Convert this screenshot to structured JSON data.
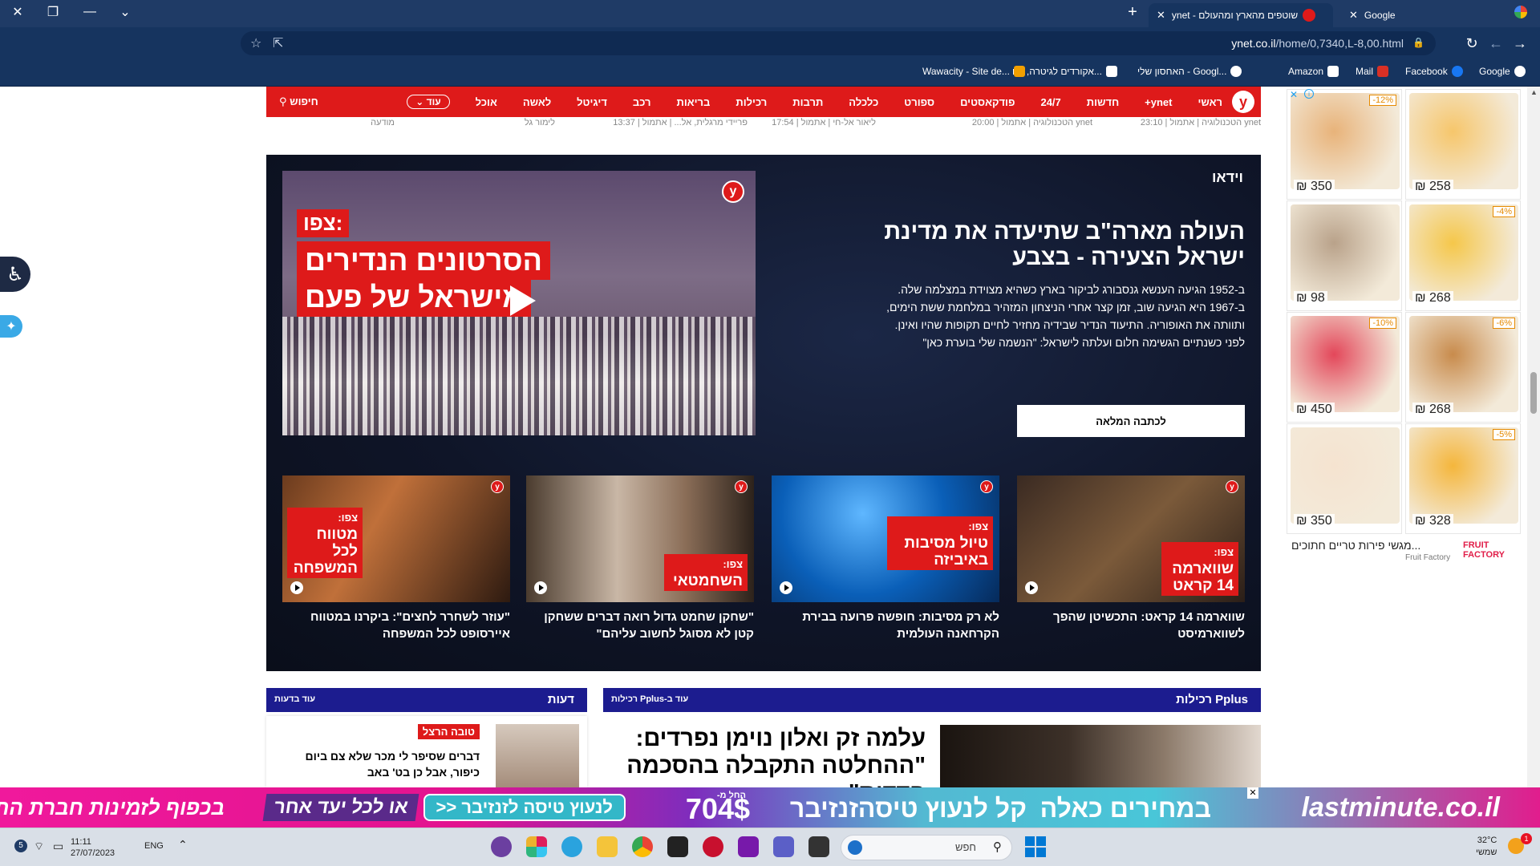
{
  "browser": {
    "tabs": [
      {
        "label": "ynet - שוטפים מהארץ ומהעולם",
        "active": true
      },
      {
        "label": "Google",
        "active": false
      }
    ],
    "url": {
      "host": "ynet.co.il",
      "path": "/home/0,7340,L-8,00.html"
    },
    "bookmarks": [
      "Google",
      "Facebook",
      "Mail",
      "Amazon",
      "האחסון שלי - Googl...",
      "אקורדים לגיטרה, תוו...",
      "Wawacity - Site de..."
    ]
  },
  "nav": {
    "logo": "y",
    "items": [
      "ראשי",
      "ynet+",
      "חדשות",
      "24/7",
      "פודקאסטים",
      "ספורט",
      "כלכלה",
      "תרבות",
      "רכילות",
      "בריאות",
      "רכב",
      "דיגיטל",
      "לאשה",
      "אוכל"
    ],
    "more": "עוד",
    "search": "חיפוש"
  },
  "meta_row": [
    "ynet הטכנולוגיה | אתמול | 23:10",
    "ynet הטכנולוגיה | אתמול | 20:00",
    "ליאור אל-חי | אתמול | 17:54",
    "פריידי מרגלית, אל... | אתמול | 13:37",
    "לימור גל",
    "מודעה"
  ],
  "video": {
    "section_label": "וידאו",
    "main_thumb": {
      "caption_label": "צפו:",
      "caption_line1": "הסרטונים הנדירים",
      "caption_line2": "מישראל של פעם",
      "badge": "y"
    },
    "title": "העולה מארה\"ב שתיעדה את מדינת ישראל הצעירה - בצבע",
    "description": [
      "ב-1952 הגיעה הענשא גנסבורג לביקור בארץ כשהיא מצוידת במצלמה שלה.",
      "ב-1967 היא הגיעה שוב, זמן קצר אחרי הניצחון המזהיר במלחמת ששת הימים,",
      "ותוותה את האופוריה. התיעוד הנדיר שבידיה מחזיר לחיים תקופות שהיו ואינן.",
      "לפני כשנתיים הגשימה חלום ועלתה לישראל: \"הנשמה שלי בוערת כאן\""
    ],
    "read_more": "לכתבה המלאה",
    "items": [
      {
        "caption_label": "צפו:",
        "caption": "שווארמה 14 קראט",
        "title": "שווארמה 14 קראט: התכשיטן שהפך לשווארמיסט"
      },
      {
        "caption_label": "צפו:",
        "caption": "טיול מסיבות באיביזה",
        "title": "לא רק מסיבות: חופשה פרועה בבירת הקרחאנה העולמית"
      },
      {
        "caption_label": "צפו:",
        "caption": "השחמטאי",
        "title": "\"שחקן שחמט גדול רואה דברים ששחקן קטן לא מסוגל לחשוב עליהם\""
      },
      {
        "caption_label": "צפו:",
        "caption": "מטווח לכל המשפחה",
        "title": "\"עוזר לשחרר לחצים\": ביקרנו במטווח איירסופט לכל המשפחה"
      }
    ]
  },
  "pplus": {
    "title": "Pplus רכילות",
    "more": "עוד ב-Pplus רכילות",
    "headline": "עלמה זק ואלון נוימן נפרדים: \"ההחלטה התקבלה בהסכמה הדדית\""
  },
  "opinions": {
    "title": "דעות",
    "more": "עוד בדעות",
    "author_tag": "טובה הרצל",
    "text": "דברים שסיפר לי מכר שלא צם ביום כיפור, אבל כן בט' באב"
  },
  "ad": {
    "items": [
      {
        "price": "₪ 258",
        "discount": "",
        "color": "#f6c66b"
      },
      {
        "price": "₪ 350",
        "discount": "-12%",
        "color": "#e8b37a"
      },
      {
        "price": "₪ 268",
        "discount": "-4%",
        "color": "#f5c74a"
      },
      {
        "price": "₪ 98",
        "discount": "",
        "color": "#b9a28a"
      },
      {
        "price": "₪ 268",
        "discount": "-6%",
        "color": "#c88b4c"
      },
      {
        "price": "₪ 450",
        "discount": "-10%",
        "color": "#e3475a"
      },
      {
        "price": "₪ 328",
        "discount": "-5%",
        "color": "#f4b63c"
      },
      {
        "price": "₪ 350",
        "discount": "",
        "color": "#f5e3d0"
      }
    ],
    "brand": "FRUIT FACTORY",
    "tagline": "מגשי פירות טריים חתוכים...",
    "brand_sub": "Fruit Factory"
  },
  "banner": {
    "brand": "lastminute.co.il",
    "t1": "במחירים כאלה",
    "t2": "קל לנעוץ טיסה",
    "t3": "זנזיבר",
    "t3b": "החל מ-",
    "price": "704$",
    "cta": "לנעוץ טיסה לזנזיבר <<",
    "t4": "או לכל יעד אחר",
    "t5": "בכפוף לזמינות חברת התעופה*"
  },
  "taskbar": {
    "search_placeholder": "חפש",
    "time": "11:11",
    "date": "27/07/2023",
    "lang": "ENG",
    "weather": "32°C",
    "weather_sub": "שמשי",
    "notif_count": "5",
    "badge": "1"
  }
}
